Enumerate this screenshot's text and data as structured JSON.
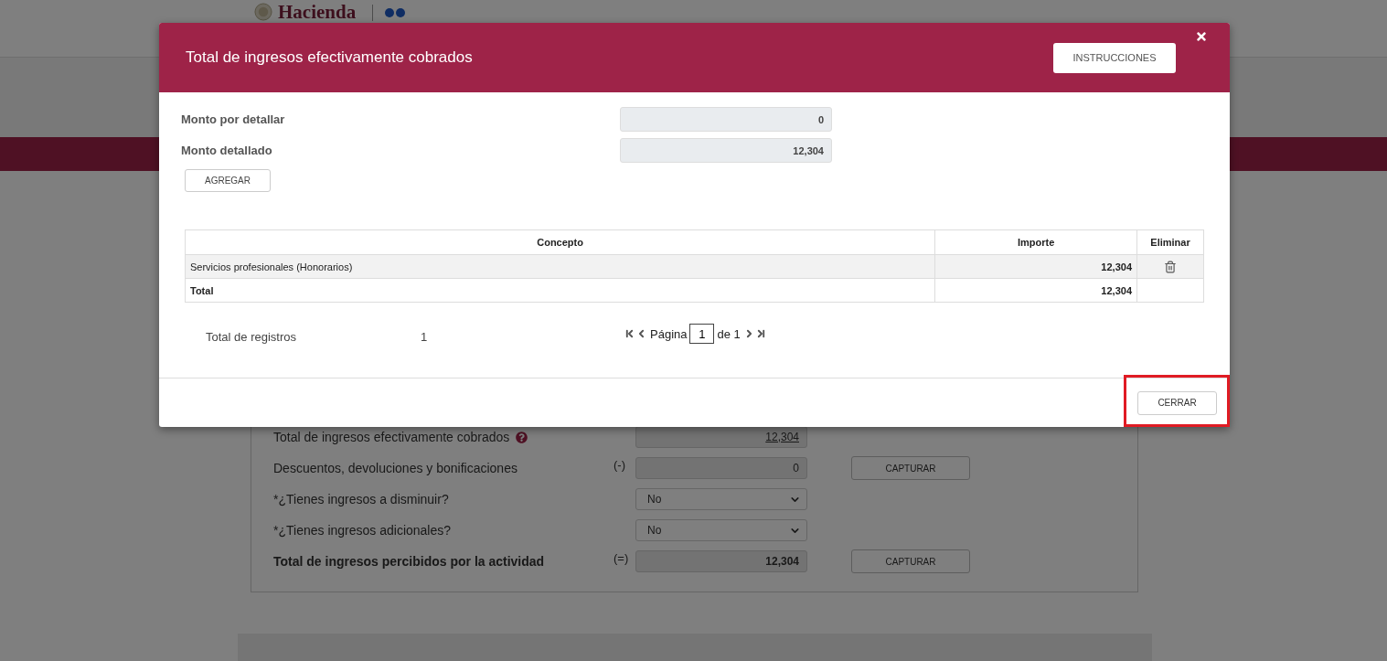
{
  "header": {
    "logo_text": "Hacienda"
  },
  "form": {
    "rows": [
      {
        "kind": "amount",
        "label": "Total de ingresos efectivamente cobrados",
        "help": true,
        "sign": "",
        "value": "12,304",
        "linked": true,
        "button": ""
      },
      {
        "kind": "amount",
        "label": "Descuentos, devoluciones y bonificaciones",
        "help": false,
        "sign": "(-)",
        "value": "0",
        "linked": false,
        "button": "CAPTURAR"
      },
      {
        "kind": "select",
        "label": "*¿Tienes ingresos a disminuir?",
        "value": "No"
      },
      {
        "kind": "select",
        "label": "*¿Tienes ingresos adicionales?",
        "value": "No"
      },
      {
        "kind": "total",
        "label": "Total de ingresos percibidos por la actividad",
        "help": false,
        "sign": "(=)",
        "value": "12,304",
        "linked": false,
        "button": "CAPTURAR"
      }
    ]
  },
  "modal": {
    "title": "Total de ingresos efectivamente cobrados",
    "instructions_button": "INSTRUCCIONES",
    "fields": [
      {
        "label": "Monto por detallar",
        "value": "0"
      },
      {
        "label": "Monto detallado",
        "value": "12,304"
      }
    ],
    "add_button": "AGREGAR",
    "table": {
      "columns": [
        "Concepto",
        "Importe",
        "Eliminar"
      ],
      "rows": [
        {
          "kind": "item",
          "concepto": "Servicios profesionales (Honorarios)",
          "importe": "12,304"
        },
        {
          "kind": "total",
          "concepto": "Total",
          "importe": "12,304"
        }
      ]
    },
    "records": {
      "label": "Total de registros",
      "count": "1"
    },
    "pager": {
      "page_label": "Página",
      "page": "1",
      "of_label": "de 1"
    },
    "close_button": {
      "label": "CERRAR",
      "highlighted": true
    }
  }
}
